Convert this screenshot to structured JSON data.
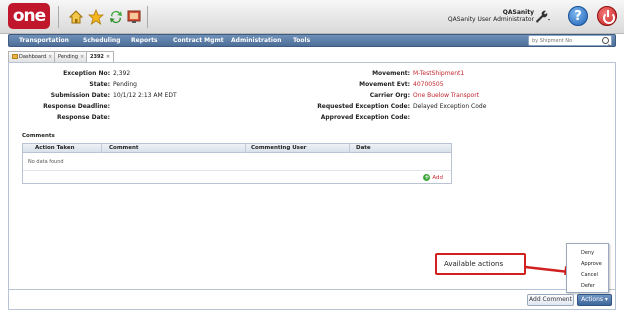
{
  "header": {
    "logo_text": "one",
    "user_name": "QASanity",
    "user_role": "QASanity User Administrator",
    "icons": [
      "home-icon",
      "favorites-star-icon",
      "refresh-icon",
      "screen-icon",
      "wrench-icon",
      "help-icon",
      "power-icon"
    ]
  },
  "nav": {
    "items": [
      "Transportation",
      "Scheduling",
      "Reports",
      "Contract Mgmt",
      "Administration",
      "Tools"
    ],
    "search_placeholder": "by Shipment No"
  },
  "tabs": [
    {
      "label": "Dashboard",
      "closable": true
    },
    {
      "label": "Pending",
      "closable": true
    },
    {
      "label": "2392",
      "closable": true,
      "active": true
    }
  ],
  "details": {
    "left": [
      {
        "label": "Exception No:",
        "value": "2,392"
      },
      {
        "label": "State:",
        "value": "Pending"
      },
      {
        "label": "Submission Date:",
        "value": "10/1/12 2:13 AM EDT"
      },
      {
        "label": "Response Deadline:",
        "value": ""
      },
      {
        "label": "Response Date:",
        "value": ""
      }
    ],
    "right": [
      {
        "label": "Movement:",
        "value": "M-TestShipment1",
        "link": true
      },
      {
        "label": "Movement Evt:",
        "value": "40700505",
        "link": true
      },
      {
        "label": "Carrier Org:",
        "value": "One Buelow Transport",
        "link": true
      },
      {
        "label": "Requested Exception Code:",
        "value": "Delayed Exception Code",
        "link": false
      },
      {
        "label": "Approved Exception Code:",
        "value": "",
        "link": false
      }
    ]
  },
  "comments": {
    "title": "Comments",
    "columns": [
      "Action Taken",
      "Comment",
      "Commenting User",
      "Date"
    ],
    "empty_text": "No data found",
    "add_label": "Add"
  },
  "footer": {
    "add_comment_label": "Add Comment",
    "actions_label": "Actions",
    "actions_menu": [
      "Deny",
      "Approve",
      "Cancel",
      "Defer"
    ]
  },
  "annotation": {
    "callout_text": "Available actions"
  },
  "colors": {
    "brand_red": "#c0172d",
    "nav_blue": "#5878a3",
    "link_red": "#c2262e",
    "callout_red": "#d02020"
  }
}
